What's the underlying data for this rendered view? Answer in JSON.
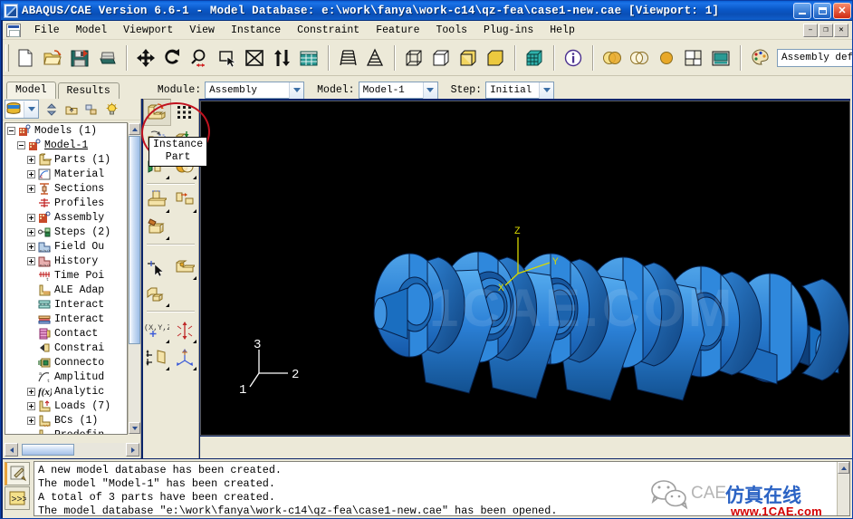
{
  "window": {
    "title": "ABAQUS/CAE Version 6.6-1 - Model Database: e:\\work\\fanya\\work-c14\\qz-fea\\case1-new.cae [Viewport: 1]",
    "icon": "abaqus-app-icon",
    "buttons": {
      "minimize": "_",
      "maximize": "□",
      "close": "✕"
    }
  },
  "menubar": {
    "items": [
      {
        "label": "File"
      },
      {
        "label": "Model"
      },
      {
        "label": "Viewport"
      },
      {
        "label": "View"
      },
      {
        "label": "Instance"
      },
      {
        "label": "Constraint"
      },
      {
        "label": "Feature"
      },
      {
        "label": "Tools"
      },
      {
        "label": "Plug-ins"
      },
      {
        "label": "Help"
      }
    ],
    "mdi_buttons": {
      "minimize": "–",
      "restore": "❐",
      "close": "✕"
    }
  },
  "toolbar": {
    "groups": [
      {
        "items": [
          {
            "name": "new-model-database-icon",
            "title": "New"
          },
          {
            "name": "open-database-icon",
            "title": "Open"
          },
          {
            "name": "save-database-icon",
            "title": "Save"
          },
          {
            "name": "print-icon",
            "title": "Print"
          }
        ]
      },
      {
        "items": [
          {
            "name": "pan-view-icon",
            "title": "Pan"
          },
          {
            "name": "rotate-view-icon",
            "title": "Rotate"
          },
          {
            "name": "magnify-view-icon",
            "title": "Magnify"
          },
          {
            "name": "box-zoom-icon",
            "title": "Box Zoom"
          },
          {
            "name": "auto-fit-view-icon",
            "title": "Auto-Fit View"
          },
          {
            "name": "cycle-views-icon",
            "title": "Cycle Views"
          },
          {
            "name": "specify-view-icon",
            "title": "Specify View"
          }
        ]
      },
      {
        "items": [
          {
            "name": "perspective-icon",
            "title": "Perspective"
          },
          {
            "name": "parallel-projection-icon",
            "title": "Parallel Projection"
          }
        ]
      },
      {
        "items": [
          {
            "name": "wireframe-render-icon",
            "title": "Wireframe"
          },
          {
            "name": "hidden-line-render-icon",
            "title": "Hidden Line"
          },
          {
            "name": "shaded-render-icon",
            "title": "Shaded"
          },
          {
            "name": "filled-render-icon",
            "title": "Filled"
          }
        ]
      },
      {
        "items": [
          {
            "name": "query-information-icon",
            "title": "Query Information"
          }
        ]
      },
      {
        "items": [
          {
            "name": "translucency-icon",
            "title": "Translucency"
          },
          {
            "name": "no-translucency-icon",
            "title": "No Translucency"
          },
          {
            "name": "color-code-icon",
            "title": "Color Code"
          },
          {
            "name": "viewport-layout-icon",
            "title": "Viewport Layout"
          },
          {
            "name": "viewport-annotation-icon",
            "title": "Viewport Annotation"
          }
        ]
      },
      {
        "items": [
          {
            "name": "color-palette-icon",
            "title": "Color Code Palette"
          }
        ]
      },
      {
        "items": [
          {
            "name": "context-help-icon",
            "title": "Context Help"
          }
        ]
      }
    ],
    "render_style": {
      "label": "Assembly defaults"
    }
  },
  "contextbar": {
    "tabs": [
      {
        "label": "Model",
        "active": true
      },
      {
        "label": "Results",
        "active": false
      }
    ],
    "fields": [
      {
        "label": "Module:",
        "value": "Assembly"
      },
      {
        "label": "Model:",
        "value": "Model-1"
      },
      {
        "label": "Step:",
        "value": "Initial"
      }
    ]
  },
  "tree": {
    "toolbar": {
      "combo_value": "model-db-icon",
      "buttons": [
        {
          "name": "tree-sort-icon"
        },
        {
          "name": "tree-parent-icon"
        },
        {
          "name": "tree-filter-icon"
        },
        {
          "name": "tree-highlight-icon"
        }
      ]
    },
    "nodes": [
      {
        "indent": 0,
        "toggle": "minus",
        "icon": "models-icon",
        "label": "Models (1)"
      },
      {
        "indent": 1,
        "toggle": "minus",
        "icon": "model-icon",
        "label": "Model-1",
        "underline": true
      },
      {
        "indent": 2,
        "toggle": "plus",
        "icon": "parts-icon",
        "label": "Parts (1)"
      },
      {
        "indent": 2,
        "toggle": "plus",
        "icon": "materials-icon",
        "label": "Material"
      },
      {
        "indent": 2,
        "toggle": "plus",
        "icon": "sections-icon",
        "label": "Sections"
      },
      {
        "indent": 2,
        "toggle": "none",
        "icon": "profiles-icon",
        "label": "Profiles"
      },
      {
        "indent": 2,
        "toggle": "plus",
        "icon": "assembly-icon",
        "label": "Assembly"
      },
      {
        "indent": 2,
        "toggle": "plus",
        "icon": "steps-icon",
        "label": "Steps (2)"
      },
      {
        "indent": 2,
        "toggle": "plus",
        "icon": "field-output-icon",
        "label": "Field Ou"
      },
      {
        "indent": 2,
        "toggle": "plus",
        "icon": "history-output-icon",
        "label": "History "
      },
      {
        "indent": 2,
        "toggle": "none",
        "icon": "time-points-icon",
        "label": "Time Poi"
      },
      {
        "indent": 2,
        "toggle": "none",
        "icon": "ale-adaptive-icon",
        "label": "ALE Adap"
      },
      {
        "indent": 2,
        "toggle": "none",
        "icon": "interactions-icon",
        "label": "Interact"
      },
      {
        "indent": 2,
        "toggle": "none",
        "icon": "interaction-properties-icon",
        "label": "Interact"
      },
      {
        "indent": 2,
        "toggle": "none",
        "icon": "contact-controls-icon",
        "label": "Contact "
      },
      {
        "indent": 2,
        "toggle": "none",
        "icon": "constraints-icon",
        "label": "Constrai"
      },
      {
        "indent": 2,
        "toggle": "none",
        "icon": "connectors-icon",
        "label": "Connecto"
      },
      {
        "indent": 2,
        "toggle": "none",
        "icon": "amplitudes-icon",
        "label": "Amplitud"
      },
      {
        "indent": 2,
        "toggle": "plus",
        "icon": "analytical-field-icon",
        "label": "Analytic"
      },
      {
        "indent": 2,
        "toggle": "plus",
        "icon": "loads-icon",
        "label": "Loads (7)"
      },
      {
        "indent": 2,
        "toggle": "plus",
        "icon": "bcs-icon",
        "label": "BCs (1)"
      },
      {
        "indent": 2,
        "toggle": "none",
        "icon": "predefined-fields-icon",
        "label": "Predefin"
      }
    ]
  },
  "toolbox": {
    "rows": [
      {
        "cells": [
          {
            "name": "instance-part-tool",
            "icon": "instance-part-icon",
            "active": true
          },
          {
            "name": "linear-pattern-tool",
            "icon": "linear-pattern-icon",
            "active": false
          }
        ]
      },
      {
        "cells": [
          {
            "name": "rotate-instance-tool",
            "icon": "rotate-instance-icon",
            "active": false
          },
          {
            "name": "translate-instance-tool",
            "icon": "translate-instance-icon",
            "active": false
          }
        ]
      },
      {
        "cells": [
          {
            "name": "translate-to-tool",
            "icon": "translate-to-icon",
            "active": false
          },
          {
            "name": "merge-cut-instances-tool",
            "icon": "merge-cut-icon",
            "active": false
          }
        ]
      },
      {
        "sep": true
      },
      {
        "cells": [
          {
            "name": "create-constraint-face-tool",
            "icon": "face-to-face-constraint-icon",
            "active": false
          },
          {
            "name": "create-constraint-edge-tool",
            "icon": "edge-to-edge-constraint-icon",
            "active": false
          }
        ]
      },
      {
        "cells": [
          {
            "name": "coaxial-constraint-tool",
            "icon": "coaxial-constraint-icon",
            "active": false
          }
        ]
      },
      {
        "sep": true
      },
      {
        "cells": [
          {
            "name": "query-instance-tool",
            "icon": "query-point-icon",
            "active": false
          },
          {
            "name": "partition-cell-tool",
            "icon": "partition-cell-icon",
            "active": false
          }
        ]
      },
      {
        "cells": [
          {
            "name": "create-cut-tool",
            "icon": "create-cut-icon",
            "active": false
          }
        ]
      },
      {
        "sep": true
      },
      {
        "cells": [
          {
            "name": "create-datum-point-tool",
            "icon": "datum-point-xyz-icon",
            "active": false
          },
          {
            "name": "create-datum-axis-tool",
            "icon": "datum-axis-icon",
            "active": false
          }
        ]
      },
      {
        "cells": [
          {
            "name": "create-datum-plane-tool",
            "icon": "datum-plane-icon",
            "active": false
          },
          {
            "name": "create-datum-csys-tool",
            "icon": "datum-csys-icon",
            "active": false
          }
        ]
      }
    ],
    "tooltip": {
      "line1": "Instance",
      "line2": "Part"
    }
  },
  "viewport": {
    "background": "#000000",
    "model_color": "#2a7fd4",
    "watermark": "1CAE.COM",
    "triad_main": {
      "x": "X",
      "y": "Y",
      "z": "Z",
      "color": "#d8d800"
    },
    "triad_corner": {
      "a1": "1",
      "a2": "2",
      "a3": "3",
      "color": "#ffffff"
    }
  },
  "messages": {
    "tabs": [
      {
        "name": "message-area-tab",
        "icon": "message-pencil-icon",
        "selected": true
      },
      {
        "name": "kernel-cli-tab",
        "icon": "python-prompt-icon",
        "selected": false
      }
    ],
    "lines": [
      "A new model database has been created.",
      "The model \"Model-1\" has been created.",
      "A total of 3 parts have been created.",
      "The model database \"e:\\work\\fanya\\work-c14\\qz-fea\\case1-new.cae\" has been opened."
    ]
  },
  "watermark": {
    "logo": "wechat-logo-icon",
    "cae_text": "CAE",
    "chinese": "仿真在线",
    "url": "www.1CAE.com"
  }
}
